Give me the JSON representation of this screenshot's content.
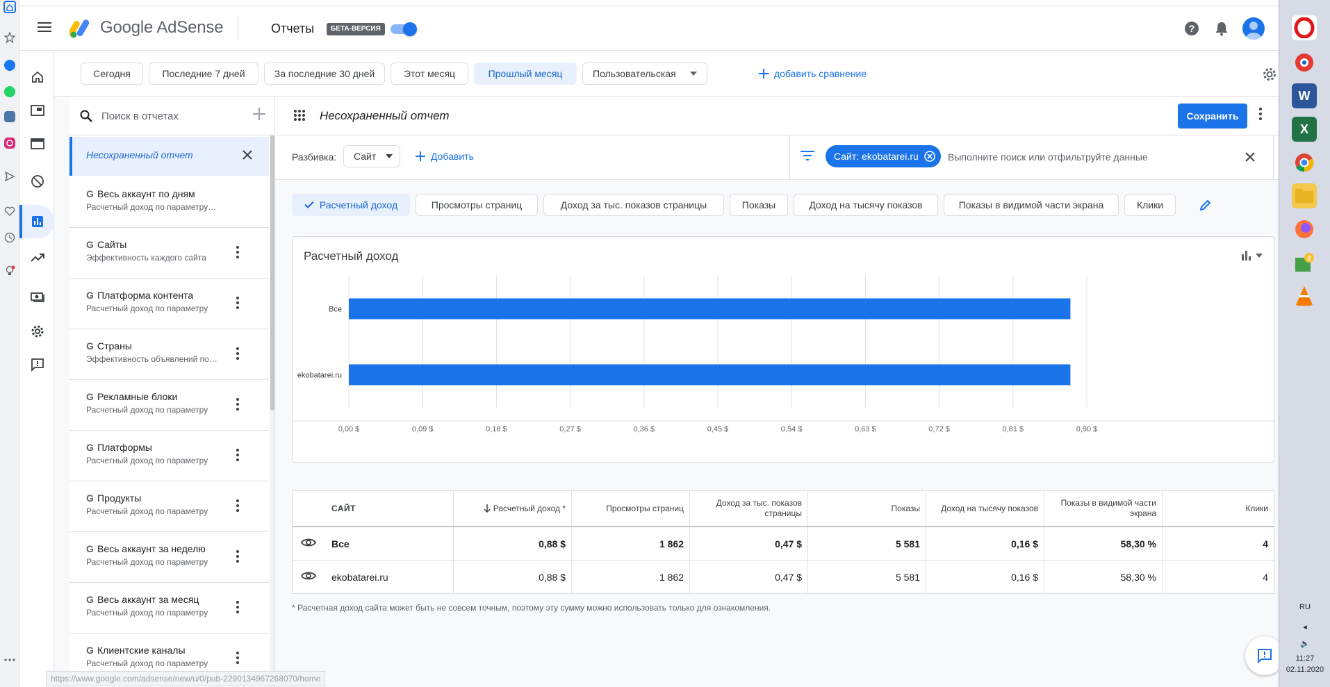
{
  "header": {
    "product": "Google AdSense",
    "section": "Отчеты",
    "beta_badge": "БЕТА-ВЕРСИЯ"
  },
  "date_range": {
    "chips": [
      {
        "label": "Сегодня",
        "active": false
      },
      {
        "label": "Последние 7 дней",
        "active": false
      },
      {
        "label": "За последние 30 дней",
        "active": false
      },
      {
        "label": "Этот месяц",
        "active": false
      },
      {
        "label": "Прошлый месяц",
        "active": true
      }
    ],
    "custom": "Пользовательская",
    "add_compare": "добавить сравнение"
  },
  "report_list": {
    "search_placeholder": "Поиск в отчетах",
    "unsaved": "Несохраненный отчет",
    "items": [
      {
        "title": "Весь аккаунт по дням",
        "subtitle": "Расчетный доход по параметру \"Дата\""
      },
      {
        "title": "Сайты",
        "subtitle": "Эффективность каждого сайта"
      },
      {
        "title": "Платформа контента",
        "subtitle": "Расчетный доход по параметру"
      },
      {
        "title": "Страны",
        "subtitle": "Эффективность объявлений по странам"
      },
      {
        "title": "Рекламные блоки",
        "subtitle": "Расчетный доход по параметру"
      },
      {
        "title": "Платформы",
        "subtitle": "Расчетный доход по параметру"
      },
      {
        "title": "Продукты",
        "subtitle": "Расчетный доход по параметру"
      },
      {
        "title": "Весь аккаунт за неделю",
        "subtitle": "Расчетный доход по параметру"
      },
      {
        "title": "Весь аккаунт за месяц",
        "subtitle": "Расчетный доход по параметру"
      },
      {
        "title": "Клиентские каналы",
        "subtitle": "Расчетный доход по параметру"
      }
    ]
  },
  "report": {
    "title": "Несохраненный отчет",
    "save": "Сохранить",
    "breakdown_label": "Разбивка:",
    "breakdown_value": "Сайт",
    "add": "Добавить",
    "filter_chip": "Сайт: ekobatarei.ru",
    "filter_placeholder": "Выполните поиск или отфильтруйте данные"
  },
  "metrics": [
    {
      "label": "Расчетный доход",
      "active": true
    },
    {
      "label": "Просмотры страниц",
      "active": false
    },
    {
      "label": "Доход за тыс. показов страницы",
      "active": false
    },
    {
      "label": "Показы",
      "active": false
    },
    {
      "label": "Доход на тысячу показов",
      "active": false
    },
    {
      "label": "Показы в видимой части экрана",
      "active": false
    },
    {
      "label": "Клики",
      "active": false
    }
  ],
  "chart_data": {
    "type": "bar",
    "orientation": "horizontal",
    "title": "Расчетный доход",
    "categories": [
      "Все",
      "ekobatarei.ru"
    ],
    "values": [
      0.88,
      0.88
    ],
    "xlim": [
      0,
      0.9
    ],
    "x_ticks": [
      "0,00 $",
      "0,09 $",
      "0,18 $",
      "0,27 $",
      "0,36 $",
      "0,45 $",
      "0,54 $",
      "0,63 $",
      "0,72 $",
      "0,81 $",
      "0,90 $"
    ],
    "grid": true,
    "color": "#1a73e8"
  },
  "table": {
    "headers": [
      "САЙТ",
      "Расчетный доход *",
      "Просмотры страниц",
      "Доход за тыс. показов страницы",
      "Показы",
      "Доход на тысячу показов",
      "Показы в видимой части экрана",
      "Клики"
    ],
    "rows": [
      [
        "Все",
        "0,88 $",
        "1 862",
        "0,47 $",
        "5 581",
        "0,16 $",
        "58,30 %",
        "4"
      ],
      [
        "ekobatarei.ru",
        "0,88 $",
        "1 862",
        "0,47 $",
        "5 581",
        "0,16 $",
        "58,30 %",
        "4"
      ]
    ],
    "footnote": "* Расчетная доход сайта может быть не совсем точным, поэтому эту сумму можно использовать только для ознакомления."
  },
  "status_url": "https://www.google.com/adsense/new/u/0/pub-2290134967268070/home",
  "taskbar": {
    "lang": "RU",
    "time": "11:27",
    "date": "02.11.2020"
  },
  "colors": {
    "accent": "#1a73e8",
    "accent_light": "#e8f0fe"
  }
}
